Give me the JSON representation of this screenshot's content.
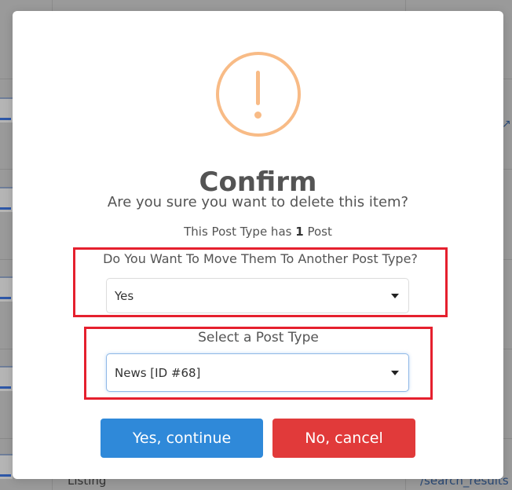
{
  "background": {
    "listing_text": "Listing",
    "url_text": "/search_results"
  },
  "dialog": {
    "icon": "warning-exclamation-icon",
    "title": "Confirm",
    "question": "Are you sure you want to delete this item?",
    "count_prefix": "This Post Type has",
    "count_value": "1",
    "count_suffix": "Post",
    "move_label": "Do You Want To Move Them To Another Post Type?",
    "move_value": "Yes",
    "post_type_label": "Select a Post Type",
    "post_type_value": "News [ID #68]",
    "confirm_label": "Yes, continue",
    "cancel_label": "No, cancel"
  },
  "colors": {
    "warning": "#f8bb86",
    "confirm": "#2f89d9",
    "cancel": "#e13a3a",
    "highlight": "#e5202e"
  }
}
